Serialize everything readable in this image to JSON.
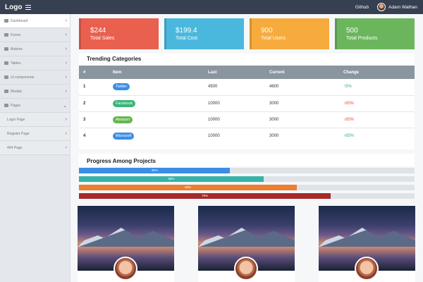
{
  "topbar": {
    "logo": "Logo",
    "github": "Github",
    "user_name": "Adam Wathan"
  },
  "sidebar": {
    "items": [
      {
        "label": "Dashboard",
        "icon": "speedometer-icon"
      },
      {
        "label": "Forms",
        "icon": "form-icon"
      },
      {
        "label": "Buttons",
        "icon": "button-icon"
      },
      {
        "label": "Tables",
        "icon": "table-icon"
      },
      {
        "label": "Ui components",
        "icon": "puzzle-icon"
      },
      {
        "label": "Modals",
        "icon": "modal-icon"
      },
      {
        "label": "Pages",
        "icon": "pages-icon"
      }
    ],
    "subitems": [
      {
        "label": "Login Page"
      },
      {
        "label": "Register Page"
      },
      {
        "label": "404 Page"
      }
    ]
  },
  "stats": [
    {
      "value": "$244",
      "label": "Total Sales",
      "color": "#e9604f"
    },
    {
      "value": "$199.4",
      "label": "Total Cost",
      "color": "#4ab8dd"
    },
    {
      "value": "900",
      "label": "Total Users",
      "color": "#f6ab3c"
    },
    {
      "value": "500",
      "label": "Total Products",
      "color": "#6bb65c"
    }
  ],
  "trending": {
    "title": "Trending Categories",
    "headers": [
      "#",
      "Item",
      "Last",
      "Current",
      "Change"
    ],
    "rows": [
      {
        "num": "1",
        "item": "Twitter",
        "item_color": "#3a8ee6",
        "last": "4500",
        "current": "4600",
        "change": "5%",
        "dir": "up"
      },
      {
        "num": "2",
        "item": "Facebook",
        "item_color": "#3cb57a",
        "last": "10000",
        "current": "3000",
        "change": "65%",
        "dir": "down"
      },
      {
        "num": "3",
        "item": "Amazon",
        "item_color": "#68b64e",
        "last": "10000",
        "current": "3000",
        "change": "65%",
        "dir": "down"
      },
      {
        "num": "4",
        "item": "Microsoft",
        "item_color": "#3a8ee6",
        "last": "10000",
        "current": "3000",
        "change": "65%",
        "dir": "up"
      }
    ]
  },
  "progress": {
    "title": "Progress Among Projects",
    "bars": [
      {
        "label": "45%",
        "value": 0.45,
        "color": "#3a8ee6"
      },
      {
        "label": "55%",
        "value": 0.55,
        "color": "#38b3a6"
      },
      {
        "label": "65%",
        "value": 0.65,
        "color": "#ed7d31"
      },
      {
        "label": "75%",
        "value": 0.75,
        "color": "#a52a2a"
      }
    ]
  },
  "cards": [
    {
      "image": "mountain-lake-photo",
      "avatar": "profile-photo"
    },
    {
      "image": "mountain-lake-photo",
      "avatar": "profile-photo"
    },
    {
      "image": "mountain-lake-photo",
      "avatar": "profile-photo"
    }
  ]
}
